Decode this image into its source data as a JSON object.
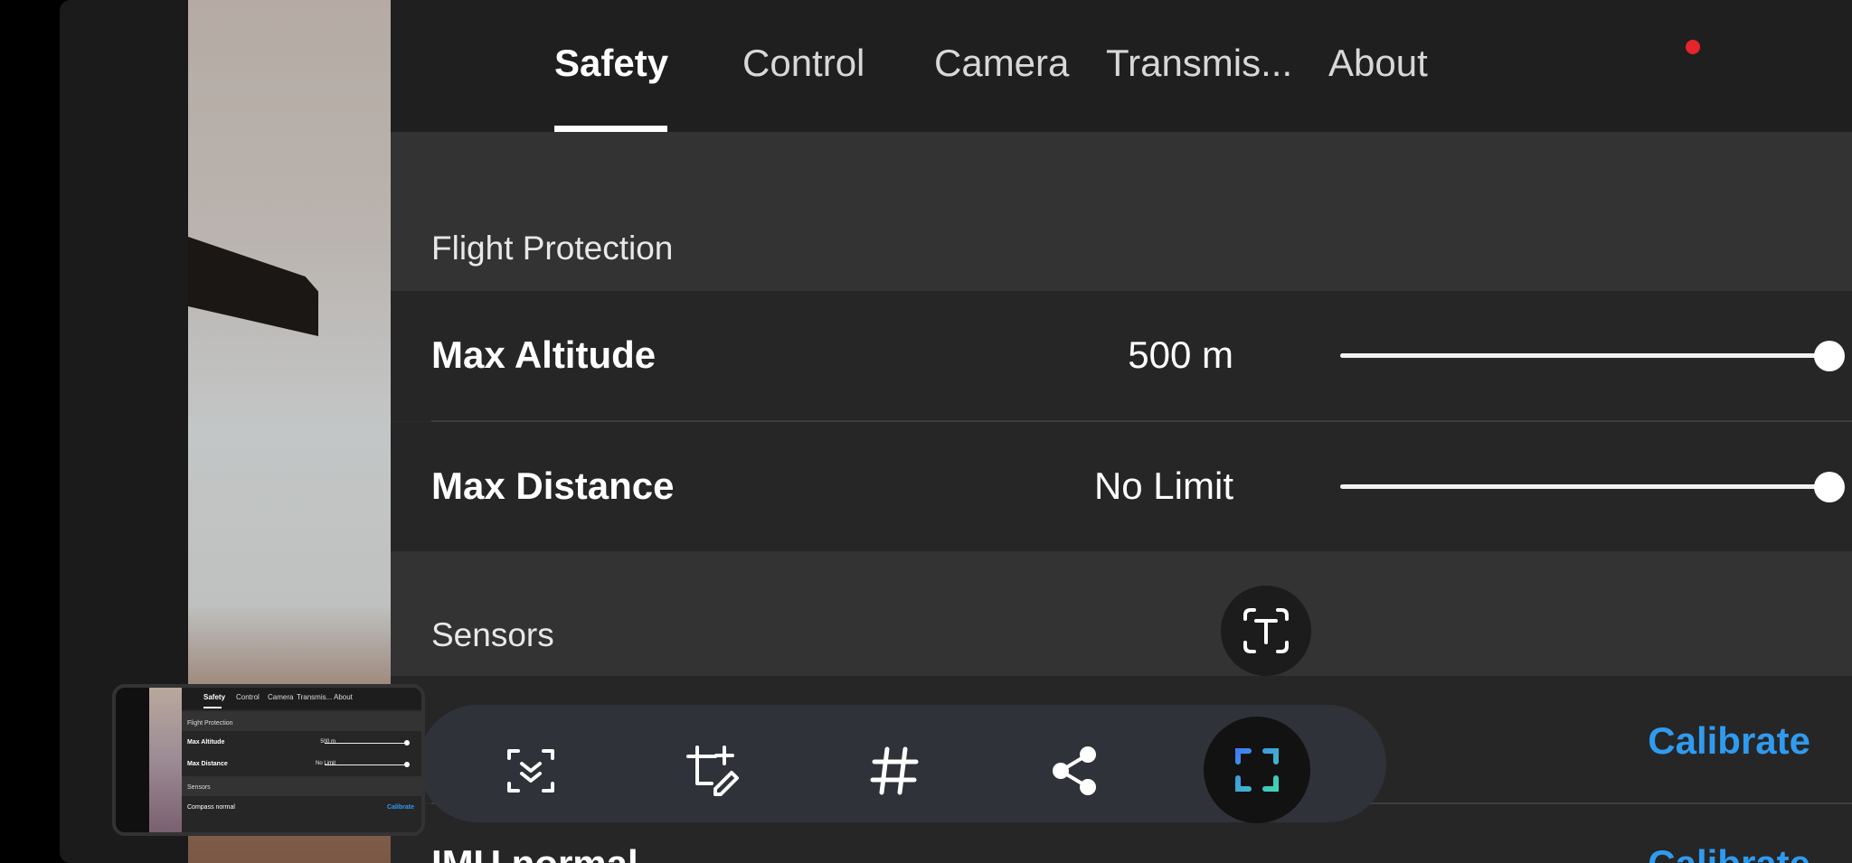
{
  "tabs": [
    {
      "label": "Safety",
      "active": true
    },
    {
      "label": "Control",
      "active": false
    },
    {
      "label": "Camera",
      "active": false
    },
    {
      "label": "Transmis...",
      "active": false
    },
    {
      "label": "About",
      "active": false,
      "notification": true
    }
  ],
  "sections": {
    "flight_protection": {
      "title": "Flight Protection",
      "rows": [
        {
          "label": "Max Altitude",
          "value": "500 m",
          "slider_level": 1.0
        },
        {
          "label": "Max Distance",
          "value": "No Limit",
          "slider_level": 1.0
        }
      ]
    },
    "sensors": {
      "title": "Sensors",
      "rows": [
        {
          "label": "",
          "action": "Calibrate"
        },
        {
          "label": "IMU normal",
          "action": "Calibrate"
        }
      ]
    }
  },
  "thumbnail": {
    "tabs": [
      "Safety",
      "Control",
      "Camera",
      "Transmis...",
      "About"
    ],
    "flight_protection": "Flight Protection",
    "max_altitude": "Max Altitude",
    "max_altitude_value": "500 m",
    "max_distance": "Max Distance",
    "max_distance_value": "No Limit",
    "sensors": "Sensors",
    "compass": "Compass normal",
    "calibrate": "Calibrate"
  },
  "toolbar": {
    "icons": [
      "scroll-capture-icon",
      "crop-edit-icon",
      "hashtag-icon",
      "share-icon",
      "scan-icon"
    ],
    "floating_icon": "text-extract-icon"
  },
  "colors": {
    "accent": "#2f9bf0",
    "notification": "#e5242b",
    "scan_gradient_start": "#3f7ef5",
    "scan_gradient_end": "#3ed4b5"
  }
}
